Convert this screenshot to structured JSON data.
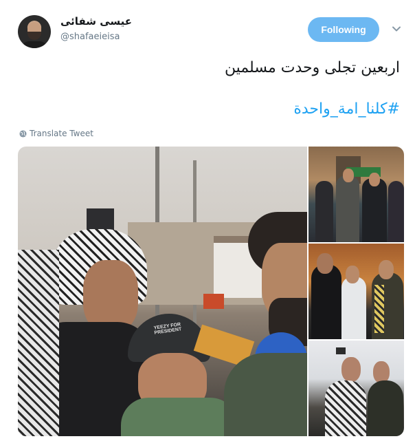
{
  "user": {
    "display_name": "عیسی شفائی",
    "handle": "@shafaeieisa"
  },
  "follow_button": {
    "label": "Following",
    "color": "#6cb8f2"
  },
  "tweet": {
    "text": "اربعین تجلی وحدت مسلمین",
    "hashtag": "#کلنا_امة_واحدة",
    "hashtag_color": "#1da1f2"
  },
  "translate": {
    "label": "Translate Tweet",
    "icon": "globe-icon"
  },
  "media": {
    "photos": [
      {
        "description": "Arbaeen pilgrims: elderly man in keffiyeh, boy in Yeezy cap, bearded man with glasses"
      },
      {
        "description": "Group of young men in scarves posing"
      },
      {
        "description": "Men in black clothing and scarves"
      },
      {
        "description": "Two men taking a selfie"
      }
    ]
  },
  "cap_text": "YEEZY FOR PRESIDENT"
}
